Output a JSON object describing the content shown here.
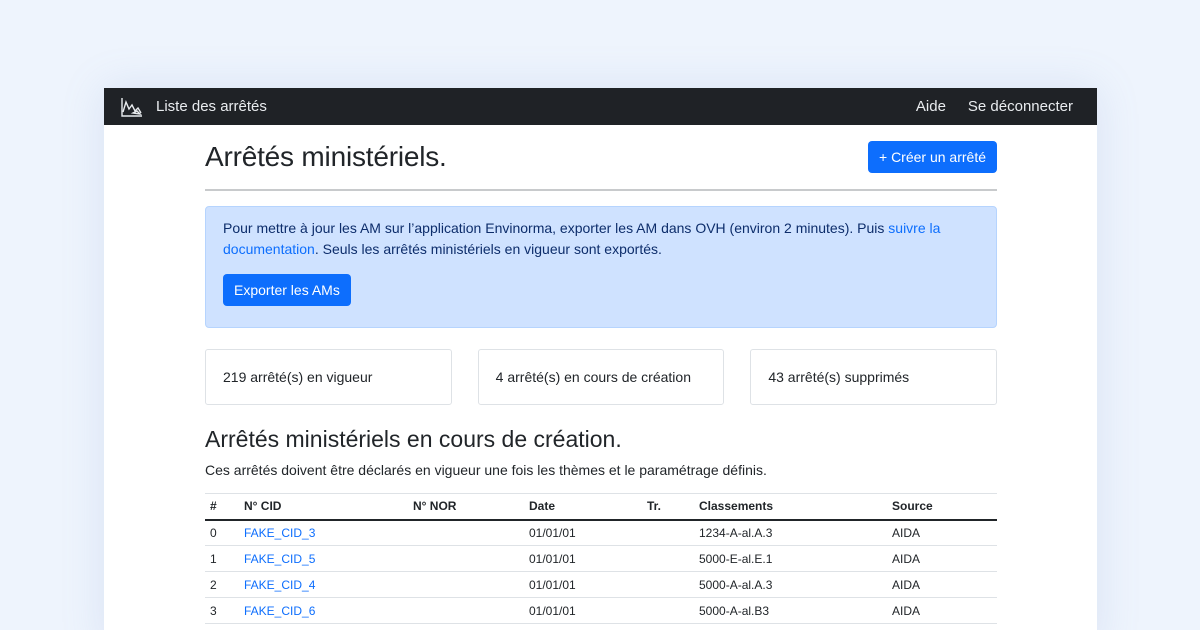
{
  "navbar": {
    "brand_label": "Liste des arrêtés",
    "help_label": "Aide",
    "logout_label": "Se déconnecter"
  },
  "header": {
    "title": "Arrêtés ministériels.",
    "create_button_label": "+ Créer un arrêté"
  },
  "alert": {
    "text_before": "Pour mettre à jour les AM sur l’application Envinorma, exporter les AM dans OVH (environ 2 minutes). Puis ",
    "link_text": "suivre la documentation",
    "text_after": ". Seuls les arrêtés ministériels en vigueur sont exportés.",
    "export_button_label": "Exporter les AMs"
  },
  "stats": [
    {
      "label": "219 arrêté(s) en vigueur"
    },
    {
      "label": "4 arrêté(s) en cours de création"
    },
    {
      "label": "43 arrêté(s) supprimés"
    }
  ],
  "section": {
    "title": "Arrêtés ministériels en cours de création.",
    "description": "Ces arrêtés doivent être déclarés en vigueur une fois les thèmes et le paramétrage définis."
  },
  "table": {
    "headers": [
      "#",
      "N° CID",
      "N° NOR",
      "Date",
      "Tr.",
      "Classements",
      "Source"
    ],
    "rows": [
      {
        "index": "0",
        "cid": "FAKE_CID_3",
        "nor": "",
        "date": "01/01/01",
        "tr": "",
        "classements": "1234-A-al.A.3",
        "source": "AIDA"
      },
      {
        "index": "1",
        "cid": "FAKE_CID_5",
        "nor": "",
        "date": "01/01/01",
        "tr": "",
        "classements": "5000-E-al.E.1",
        "source": "AIDA"
      },
      {
        "index": "2",
        "cid": "FAKE_CID_4",
        "nor": "",
        "date": "01/01/01",
        "tr": "",
        "classements": "5000-A-al.A.3",
        "source": "AIDA"
      },
      {
        "index": "3",
        "cid": "FAKE_CID_6",
        "nor": "",
        "date": "01/01/01",
        "tr": "",
        "classements": "5000-A-al.B3",
        "source": "AIDA"
      }
    ]
  },
  "colors": {
    "navbar_bg": "#1f2226",
    "primary": "#0d6efd",
    "alert_bg": "#cfe2ff",
    "page_bg": "#eef4fd"
  }
}
